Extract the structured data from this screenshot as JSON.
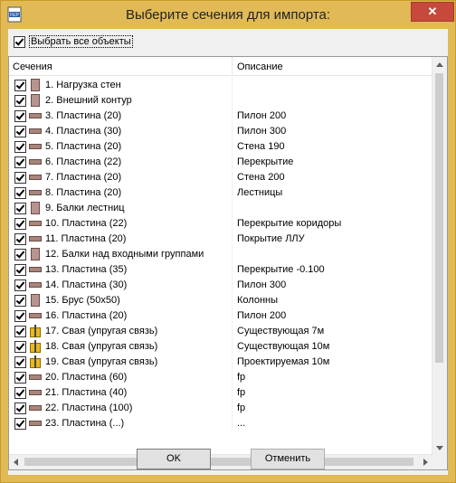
{
  "window": {
    "title": "Выберите сечения для импорта:",
    "close_symbol": "✕",
    "app_icon_text": "FEP"
  },
  "select_all": {
    "label": "Выбрать все объекты",
    "checked": true
  },
  "columns": {
    "sections": "Сечения",
    "description": "Описание"
  },
  "rows": [
    {
      "name": "1. Нагрузка стен",
      "desc": "",
      "icon": "wall-icon"
    },
    {
      "name": "2. Внешний контур",
      "desc": "",
      "icon": "wall-icon"
    },
    {
      "name": "3. Пластина (20)",
      "desc": "Пилон 200",
      "icon": "plate-icon"
    },
    {
      "name": "4. Пластина (30)",
      "desc": "Пилон 300",
      "icon": "plate-icon"
    },
    {
      "name": "5. Пластина (20)",
      "desc": "Стена 190",
      "icon": "plate-icon"
    },
    {
      "name": "6. Пластина (22)",
      "desc": "Перекрытие",
      "icon": "plate-icon"
    },
    {
      "name": "7. Пластина (20)",
      "desc": "Стена 200",
      "icon": "plate-icon"
    },
    {
      "name": "8. Пластина (20)",
      "desc": "Лестницы",
      "icon": "plate-icon"
    },
    {
      "name": "9. Балки лестниц",
      "desc": "",
      "icon": "wall-icon"
    },
    {
      "name": "10. Пластина (22)",
      "desc": "Перекрытие коридоры",
      "icon": "plate-icon"
    },
    {
      "name": "11. Пластина (20)",
      "desc": "Покрытие ЛЛУ",
      "icon": "plate-icon"
    },
    {
      "name": "12. Балки над входными группами",
      "desc": "",
      "icon": "wall-icon"
    },
    {
      "name": "13. Пластина (35)",
      "desc": "Перекрытие -0.100",
      "icon": "plate-icon"
    },
    {
      "name": "14. Пластина (30)",
      "desc": "Пилон 300",
      "icon": "plate-icon"
    },
    {
      "name": "15. Брус (50x50)",
      "desc": "Колонны",
      "icon": "wall-icon"
    },
    {
      "name": "16. Пластина (20)",
      "desc": "Пилон 200",
      "icon": "plate-icon"
    },
    {
      "name": "17. Свая (упругая связь)",
      "desc": "Существующая 7м",
      "icon": "pile-icon"
    },
    {
      "name": "18. Свая (упругая связь)",
      "desc": "Существующая 10м",
      "icon": "pile-icon"
    },
    {
      "name": "19. Свая (упругая связь)",
      "desc": "Проектируемая 10м",
      "icon": "pile-icon"
    },
    {
      "name": "20. Пластина (60)",
      "desc": "fp",
      "icon": "plate-icon"
    },
    {
      "name": "21. Пластина (40)",
      "desc": "fp",
      "icon": "plate-icon"
    },
    {
      "name": "22. Пластина (100)",
      "desc": "fp",
      "icon": "plate-icon"
    },
    {
      "name": "23. Пластина (...)",
      "desc": "...",
      "icon": "plate-icon"
    }
  ],
  "buttons": {
    "ok": "OK",
    "cancel": "Отменить"
  }
}
